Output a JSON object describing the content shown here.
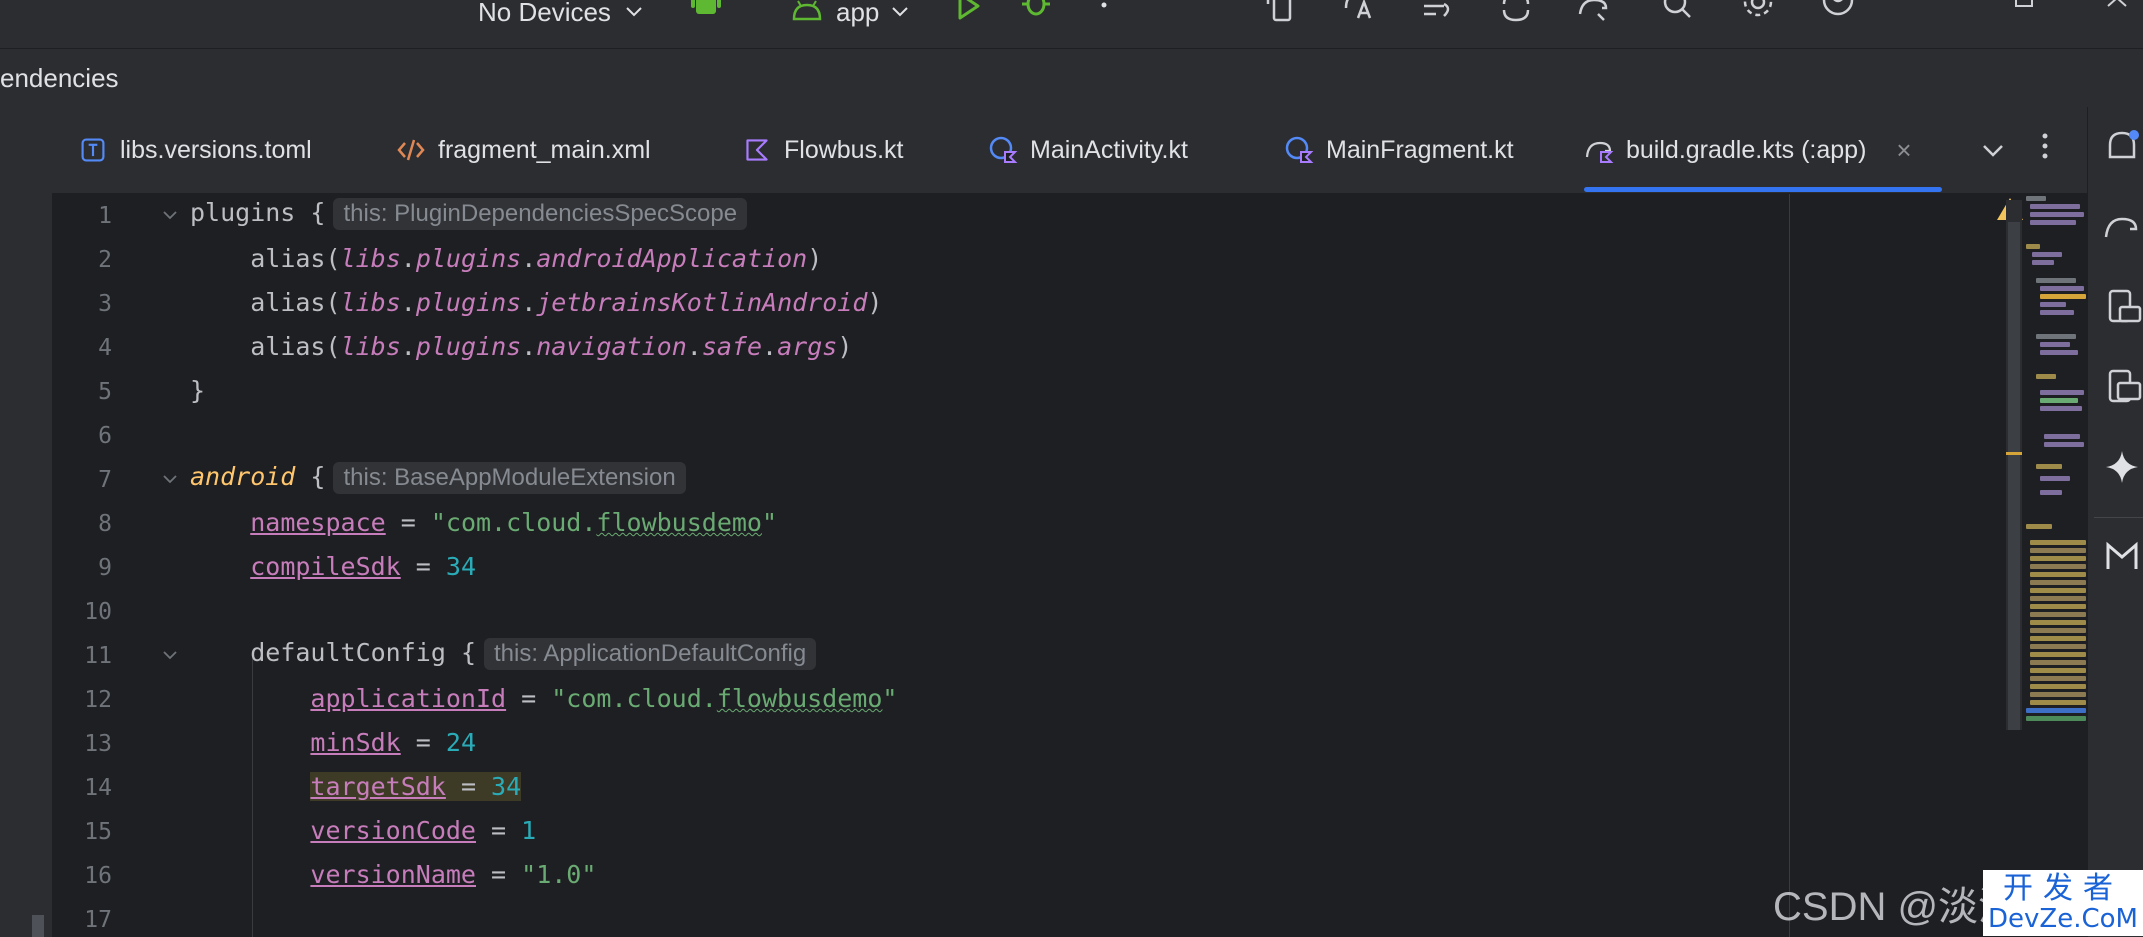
{
  "toolbar": {
    "device_label": "No Devices",
    "config_label": "app"
  },
  "breadcrumb": {
    "text": "endencies"
  },
  "tabs": [
    {
      "label": "libs.versions.toml",
      "icon": "toml-icon"
    },
    {
      "label": "fragment_main.xml",
      "icon": "xml-icon"
    },
    {
      "label": "Flowbus.kt",
      "icon": "kotlin-icon"
    },
    {
      "label": "MainActivity.kt",
      "icon": "kotlin-class-icon"
    },
    {
      "label": "MainFragment.kt",
      "icon": "kotlin-class-icon"
    },
    {
      "label": "build.gradle.kts (:app)",
      "icon": "gradle-icon",
      "close": "×"
    }
  ],
  "editor": {
    "line_numbers": [
      "1",
      "2",
      "3",
      "4",
      "5",
      "6",
      "7",
      "8",
      "9",
      "10",
      "11",
      "12",
      "13",
      "14",
      "15",
      "16",
      "17"
    ],
    "hints": {
      "plugins": "this: PluginDependenciesSpecScope",
      "android": "this: BaseAppModuleExtension",
      "defaultConfig": "this: ApplicationDefaultConfig"
    },
    "tokens": {
      "plugins": "plugins",
      "alias": "alias",
      "libs": "libs",
      "plugins_word": "plugins",
      "androidApplication": "androidApplication",
      "jetbrainsKotlinAndroid": "jetbrainsKotlinAndroid",
      "navigation": "navigation",
      "safe": "safe",
      "args": "args",
      "android": "android",
      "namespace": "namespace",
      "namespace_val_a": "\"com.cloud.",
      "namespace_val_b": "flowbusdemo",
      "namespace_val_c": "\"",
      "compileSdk": "compileSdk",
      "compileSdk_val": "34",
      "defaultConfig": "defaultConfig",
      "applicationId": "applicationId",
      "applicationId_val_a": "\"com.cloud.",
      "applicationId_val_b": "flowbusdemo",
      "applicationId_val_c": "\"",
      "minSdk": "minSdk",
      "minSdk_val": "24",
      "targetSdk": "targetSdk",
      "targetSdk_val": "34",
      "versionCode": "versionCode",
      "versionCode_val": "1",
      "versionName": "versionName",
      "versionName_val": "\"1.0\""
    }
  },
  "watermark": {
    "text": "CSDN @淡淡",
    "logo_top": "开发者",
    "logo_bottom": "DevZe.CoM"
  },
  "colors": {
    "accent": "#3574f0",
    "string": "#6aab73",
    "number": "#2aacb8",
    "property": "#c77dbb",
    "keyword_block": "#ffc66d",
    "warning": "#f2c55c"
  }
}
